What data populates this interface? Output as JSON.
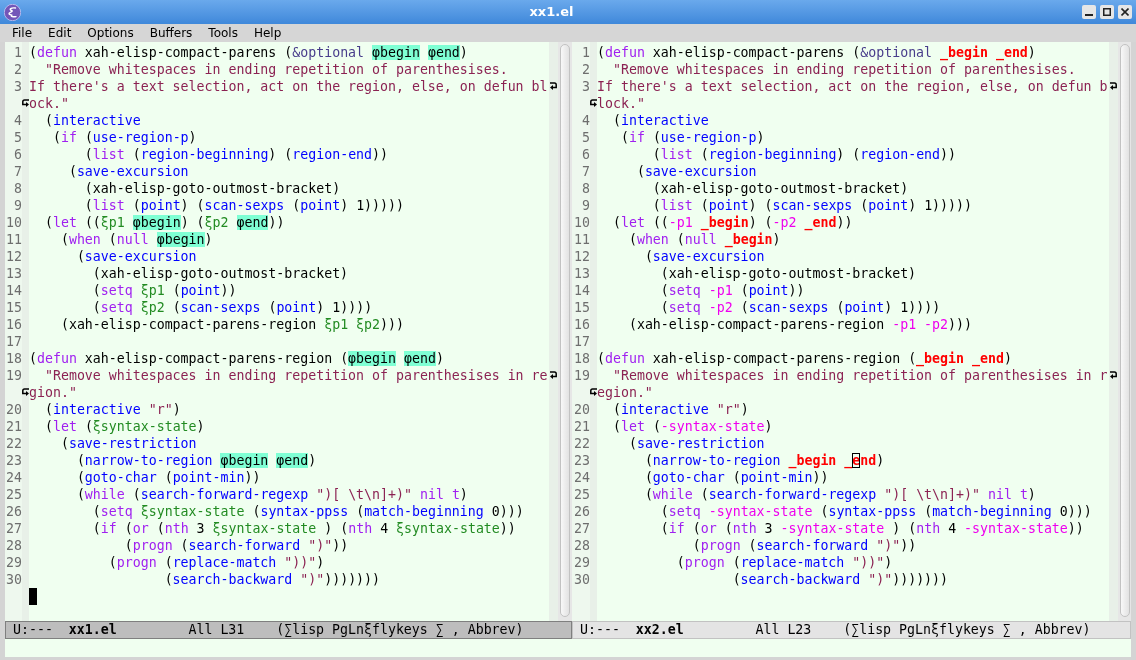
{
  "window": {
    "title": "xx1.el"
  },
  "menu": [
    "File",
    "Edit",
    "Options",
    "Buffers",
    "Tools",
    "Help"
  ],
  "windows": [
    {
      "selected": true,
      "lines": [
        {
          "number": "1",
          "rows": [
            [
              {
                "kind": "plain",
                "text": "("
              },
              {
                "kind": "keyword",
                "text": "defun"
              },
              {
                "kind": "plain",
                "text": " xah-elisp-compact-parens ("
              },
              {
                "kind": "modifier",
                "text": "&optional"
              },
              {
                "kind": "highlight",
                "text": " φbegin"
              },
              {
                "kind": "highlight",
                "text": " φend"
              },
              {
                "kind": "plain",
                "text": ")"
              }
            ]
          ]
        },
        {
          "number": "2",
          "rows": [
            [
              {
                "kind": "string",
                "text": "  \"Remove whitespaces in ending repetition of parenthesises."
              }
            ]
          ]
        },
        {
          "number": "3",
          "rows": [
            [
              {
                "kind": "string",
                "text": "If there's a text selection, act on the region, else, on defun bl"
              }
            ],
            [
              {
                "kind": "string",
                "text": "ock.\""
              }
            ]
          ]
        },
        {
          "number": "4",
          "rows": [
            [
              {
                "kind": "plain",
                "text": "  ("
              },
              {
                "kind": "function",
                "text": "interactive"
              }
            ]
          ]
        },
        {
          "number": "5",
          "rows": [
            [
              {
                "kind": "plain",
                "text": "   ("
              },
              {
                "kind": "keyword",
                "text": "if"
              },
              {
                "kind": "plain",
                "text": " ("
              },
              {
                "kind": "function",
                "text": "use-region-p"
              },
              {
                "kind": "plain",
                "text": ")"
              }
            ]
          ]
        },
        {
          "number": "6",
          "rows": [
            [
              {
                "kind": "plain",
                "text": "       ("
              },
              {
                "kind": "keyword",
                "text": "list"
              },
              {
                "kind": "plain",
                "text": " ("
              },
              {
                "kind": "function",
                "text": "region-beginning"
              },
              {
                "kind": "plain",
                "text": ") ("
              },
              {
                "kind": "function",
                "text": "region-end"
              },
              {
                "kind": "plain",
                "text": "))"
              }
            ]
          ]
        },
        {
          "number": "7",
          "rows": [
            [
              {
                "kind": "plain",
                "text": "     ("
              },
              {
                "kind": "function",
                "text": "save-excursion"
              }
            ]
          ]
        },
        {
          "number": "8",
          "rows": [
            [
              {
                "kind": "plain",
                "text": "       (xah-elisp-goto-outmost-bracket)"
              }
            ]
          ]
        },
        {
          "number": "9",
          "rows": [
            [
              {
                "kind": "plain",
                "text": "       ("
              },
              {
                "kind": "keyword",
                "text": "list"
              },
              {
                "kind": "plain",
                "text": " ("
              },
              {
                "kind": "function",
                "text": "point"
              },
              {
                "kind": "plain",
                "text": ") ("
              },
              {
                "kind": "function",
                "text": "scan-sexps"
              },
              {
                "kind": "plain",
                "text": " ("
              },
              {
                "kind": "function",
                "text": "point"
              },
              {
                "kind": "plain",
                "text": ") 1)))))"
              }
            ]
          ]
        },
        {
          "number": "10",
          "rows": [
            [
              {
                "kind": "plain",
                "text": "  ("
              },
              {
                "kind": "keyword",
                "text": "let"
              },
              {
                "kind": "plain",
                "text": " (("
              },
              {
                "kind": "variable",
                "text": "ξp1"
              },
              {
                "kind": "highlight",
                "text": " φbegin"
              },
              {
                "kind": "plain",
                "text": ") ("
              },
              {
                "kind": "variable",
                "text": "ξp2"
              },
              {
                "kind": "highlight",
                "text": " φend"
              },
              {
                "kind": "plain",
                "text": "))"
              }
            ]
          ]
        },
        {
          "number": "11",
          "rows": [
            [
              {
                "kind": "plain",
                "text": "    ("
              },
              {
                "kind": "keyword",
                "text": "when"
              },
              {
                "kind": "plain",
                "text": " ("
              },
              {
                "kind": "keyword",
                "text": "null"
              },
              {
                "kind": "highlight",
                "text": " φbegin"
              },
              {
                "kind": "plain",
                "text": ")"
              }
            ]
          ]
        },
        {
          "number": "12",
          "rows": [
            [
              {
                "kind": "plain",
                "text": "      ("
              },
              {
                "kind": "function",
                "text": "save-excursion"
              }
            ]
          ]
        },
        {
          "number": "13",
          "rows": [
            [
              {
                "kind": "plain",
                "text": "        (xah-elisp-goto-outmost-bracket)"
              }
            ]
          ]
        },
        {
          "number": "14",
          "rows": [
            [
              {
                "kind": "plain",
                "text": "        ("
              },
              {
                "kind": "keyword",
                "text": "setq"
              },
              {
                "kind": "variable",
                "text": " ξp1"
              },
              {
                "kind": "plain",
                "text": " ("
              },
              {
                "kind": "function",
                "text": "point"
              },
              {
                "kind": "plain",
                "text": "))"
              }
            ]
          ]
        },
        {
          "number": "15",
          "rows": [
            [
              {
                "kind": "plain",
                "text": "        ("
              },
              {
                "kind": "keyword",
                "text": "setq"
              },
              {
                "kind": "variable",
                "text": " ξp2"
              },
              {
                "kind": "plain",
                "text": " ("
              },
              {
                "kind": "function",
                "text": "scan-sexps"
              },
              {
                "kind": "plain",
                "text": " ("
              },
              {
                "kind": "function",
                "text": "point"
              },
              {
                "kind": "plain",
                "text": ") 1))))"
              }
            ]
          ]
        },
        {
          "number": "16",
          "rows": [
            [
              {
                "kind": "plain",
                "text": "    (xah-elisp-compact-parens-region"
              },
              {
                "kind": "variable",
                "text": " ξp1"
              },
              {
                "kind": "variable",
                "text": " ξp2"
              },
              {
                "kind": "plain",
                "text": ")))"
              }
            ]
          ]
        },
        {
          "number": "17"
        },
        {
          "number": "18",
          "rows": [
            [
              {
                "kind": "plain",
                "text": "("
              },
              {
                "kind": "keyword",
                "text": "defun"
              },
              {
                "kind": "plain",
                "text": " xah-elisp-compact-parens-region ("
              },
              {
                "kind": "highlight",
                "text": "φbegin"
              },
              {
                "kind": "highlight",
                "text": " φend"
              },
              {
                "kind": "plain",
                "text": ")"
              }
            ]
          ]
        },
        {
          "number": "19",
          "rows": [
            [
              {
                "kind": "string",
                "text": "  \"Remove whitespaces in ending repetition of parenthesises in re"
              }
            ],
            [
              {
                "kind": "string",
                "text": "gion.\""
              }
            ]
          ]
        },
        {
          "number": "20",
          "rows": [
            [
              {
                "kind": "plain",
                "text": "  ("
              },
              {
                "kind": "function",
                "text": "interactive"
              },
              {
                "kind": "string",
                "text": " \"r\""
              },
              {
                "kind": "plain",
                "text": ")"
              }
            ]
          ]
        },
        {
          "number": "21",
          "rows": [
            [
              {
                "kind": "plain",
                "text": "  ("
              },
              {
                "kind": "keyword",
                "text": "let"
              },
              {
                "kind": "plain",
                "text": " ("
              },
              {
                "kind": "variable",
                "text": "ξsyntax-state"
              },
              {
                "kind": "plain",
                "text": ")"
              }
            ]
          ]
        },
        {
          "number": "22",
          "rows": [
            [
              {
                "kind": "plain",
                "text": "    ("
              },
              {
                "kind": "function",
                "text": "save-restriction"
              }
            ]
          ]
        },
        {
          "number": "23",
          "rows": [
            [
              {
                "kind": "plain",
                "text": "      ("
              },
              {
                "kind": "function",
                "text": "narrow-to-region"
              },
              {
                "kind": "highlight",
                "text": " φbegin"
              },
              {
                "kind": "highlight",
                "text": " φend"
              },
              {
                "kind": "plain",
                "text": ")"
              }
            ]
          ]
        },
        {
          "number": "24",
          "rows": [
            [
              {
                "kind": "plain",
                "text": "      ("
              },
              {
                "kind": "function",
                "text": "goto-char"
              },
              {
                "kind": "plain",
                "text": " ("
              },
              {
                "kind": "function",
                "text": "point-min"
              },
              {
                "kind": "plain",
                "text": "))"
              }
            ]
          ]
        },
        {
          "number": "25",
          "rows": [
            [
              {
                "kind": "plain",
                "text": "      ("
              },
              {
                "kind": "keyword",
                "text": "while"
              },
              {
                "kind": "plain",
                "text": " ("
              },
              {
                "kind": "function",
                "text": "search-forward-regexp"
              },
              {
                "kind": "string",
                "text": " \")[ \\t\\n]+)\""
              },
              {
                "kind": "keyword",
                "text": " nil"
              },
              {
                "kind": "keyword",
                "text": " t"
              },
              {
                "kind": "plain",
                "text": ")"
              }
            ]
          ]
        },
        {
          "number": "26",
          "rows": [
            [
              {
                "kind": "plain",
                "text": "        ("
              },
              {
                "kind": "keyword",
                "text": "setq"
              },
              {
                "kind": "variable",
                "text": " ξsyntax-state"
              },
              {
                "kind": "plain",
                "text": " ("
              },
              {
                "kind": "function",
                "text": "syntax-ppss"
              },
              {
                "kind": "plain",
                "text": " ("
              },
              {
                "kind": "function",
                "text": "match-beginning"
              },
              {
                "kind": "plain",
                "text": " 0)))"
              }
            ]
          ]
        },
        {
          "number": "27",
          "rows": [
            [
              {
                "kind": "plain",
                "text": "        ("
              },
              {
                "kind": "keyword",
                "text": "if"
              },
              {
                "kind": "plain",
                "text": " ("
              },
              {
                "kind": "keyword",
                "text": "or"
              },
              {
                "kind": "plain",
                "text": " ("
              },
              {
                "kind": "keyword",
                "text": "nth"
              },
              {
                "kind": "plain",
                "text": " 3"
              },
              {
                "kind": "variable",
                "text": " ξsyntax-state"
              },
              {
                "kind": "plain",
                "text": " ) ("
              },
              {
                "kind": "keyword",
                "text": "nth"
              },
              {
                "kind": "plain",
                "text": " 4"
              },
              {
                "kind": "variable",
                "text": " ξsyntax-state"
              },
              {
                "kind": "plain",
                "text": "))"
              }
            ]
          ]
        },
        {
          "number": "28",
          "rows": [
            [
              {
                "kind": "plain",
                "text": "            ("
              },
              {
                "kind": "keyword",
                "text": "progn"
              },
              {
                "kind": "plain",
                "text": " ("
              },
              {
                "kind": "function",
                "text": "search-forward"
              },
              {
                "kind": "string",
                "text": " \")\""
              },
              {
                "kind": "plain",
                "text": "))"
              }
            ]
          ]
        },
        {
          "number": "29",
          "rows": [
            [
              {
                "kind": "plain",
                "text": "          ("
              },
              {
                "kind": "keyword",
                "text": "progn"
              },
              {
                "kind": "plain",
                "text": " ("
              },
              {
                "kind": "function",
                "text": "replace-match"
              },
              {
                "kind": "string",
                "text": " \"))\""
              },
              {
                "kind": "plain",
                "text": ")"
              }
            ]
          ]
        },
        {
          "number": "30",
          "rows": [
            [
              {
                "kind": "plain",
                "text": "                 ("
              },
              {
                "kind": "function",
                "text": "search-backward"
              },
              {
                "kind": "string",
                "text": " \")\""
              },
              {
                "kind": "plain",
                "text": ")))))))"
              }
            ]
          ]
        },
        {
          "cursor": true
        }
      ],
      "mode_line": {
        "status": "U:---",
        "buffer": "xx1.el",
        "position": "All L31",
        "modes": "(∑lisp PgLnξflykeys ∑ , Abbrev)"
      }
    },
    {
      "selected": false,
      "lines": [
        {
          "number": "1",
          "rows": [
            [
              {
                "kind": "plain",
                "text": "("
              },
              {
                "kind": "keyword",
                "text": "defun"
              },
              {
                "kind": "plain",
                "text": " xah-elisp-compact-parens ("
              },
              {
                "kind": "modifier",
                "text": "&optional"
              },
              {
                "kind": "param",
                "text": " _begin"
              },
              {
                "kind": "param",
                "text": " _end"
              },
              {
                "kind": "plain",
                "text": ")"
              }
            ]
          ]
        },
        {
          "number": "2",
          "rows": [
            [
              {
                "kind": "string",
                "text": "  \"Remove whitespaces in ending repetition of parenthesises."
              }
            ]
          ]
        },
        {
          "number": "3",
          "rows": [
            [
              {
                "kind": "string",
                "text": "If there's a text selection, act on the region, else, on defun b"
              }
            ],
            [
              {
                "kind": "string",
                "text": "lock.\""
              }
            ]
          ]
        },
        {
          "number": "4",
          "rows": [
            [
              {
                "kind": "plain",
                "text": "  ("
              },
              {
                "kind": "function",
                "text": "interactive"
              }
            ]
          ]
        },
        {
          "number": "5",
          "rows": [
            [
              {
                "kind": "plain",
                "text": "   ("
              },
              {
                "kind": "keyword",
                "text": "if"
              },
              {
                "kind": "plain",
                "text": " ("
              },
              {
                "kind": "function",
                "text": "use-region-p"
              },
              {
                "kind": "plain",
                "text": ")"
              }
            ]
          ]
        },
        {
          "number": "6",
          "rows": [
            [
              {
                "kind": "plain",
                "text": "       ("
              },
              {
                "kind": "keyword",
                "text": "list"
              },
              {
                "kind": "plain",
                "text": " ("
              },
              {
                "kind": "function",
                "text": "region-beginning"
              },
              {
                "kind": "plain",
                "text": ") ("
              },
              {
                "kind": "function",
                "text": "region-end"
              },
              {
                "kind": "plain",
                "text": "))"
              }
            ]
          ]
        },
        {
          "number": "7",
          "rows": [
            [
              {
                "kind": "plain",
                "text": "     ("
              },
              {
                "kind": "function",
                "text": "save-excursion"
              }
            ]
          ]
        },
        {
          "number": "8",
          "rows": [
            [
              {
                "kind": "plain",
                "text": "       (xah-elisp-goto-outmost-bracket)"
              }
            ]
          ]
        },
        {
          "number": "9",
          "rows": [
            [
              {
                "kind": "plain",
                "text": "       ("
              },
              {
                "kind": "keyword",
                "text": "list"
              },
              {
                "kind": "plain",
                "text": " ("
              },
              {
                "kind": "function",
                "text": "point"
              },
              {
                "kind": "plain",
                "text": ") ("
              },
              {
                "kind": "function",
                "text": "scan-sexps"
              },
              {
                "kind": "plain",
                "text": " ("
              },
              {
                "kind": "function",
                "text": "point"
              },
              {
                "kind": "plain",
                "text": ") 1)))))"
              }
            ]
          ]
        },
        {
          "number": "10",
          "rows": [
            [
              {
                "kind": "plain",
                "text": "  ("
              },
              {
                "kind": "keyword",
                "text": "let"
              },
              {
                "kind": "plain",
                "text": " (("
              },
              {
                "kind": "local",
                "text": "-p1"
              },
              {
                "kind": "param",
                "text": " _begin"
              },
              {
                "kind": "plain",
                "text": ") ("
              },
              {
                "kind": "local",
                "text": "-p2"
              },
              {
                "kind": "param",
                "text": " _end"
              },
              {
                "kind": "plain",
                "text": "))"
              }
            ]
          ]
        },
        {
          "number": "11",
          "rows": [
            [
              {
                "kind": "plain",
                "text": "    ("
              },
              {
                "kind": "keyword",
                "text": "when"
              },
              {
                "kind": "plain",
                "text": " ("
              },
              {
                "kind": "keyword",
                "text": "null"
              },
              {
                "kind": "param",
                "text": " _begin"
              },
              {
                "kind": "plain",
                "text": ")"
              }
            ]
          ]
        },
        {
          "number": "12",
          "rows": [
            [
              {
                "kind": "plain",
                "text": "      ("
              },
              {
                "kind": "function",
                "text": "save-excursion"
              }
            ]
          ]
        },
        {
          "number": "13",
          "rows": [
            [
              {
                "kind": "plain",
                "text": "        (xah-elisp-goto-outmost-bracket)"
              }
            ]
          ]
        },
        {
          "number": "14",
          "rows": [
            [
              {
                "kind": "plain",
                "text": "        ("
              },
              {
                "kind": "keyword",
                "text": "setq"
              },
              {
                "kind": "local",
                "text": " -p1"
              },
              {
                "kind": "plain",
                "text": " ("
              },
              {
                "kind": "function",
                "text": "point"
              },
              {
                "kind": "plain",
                "text": "))"
              }
            ]
          ]
        },
        {
          "number": "15",
          "rows": [
            [
              {
                "kind": "plain",
                "text": "        ("
              },
              {
                "kind": "keyword",
                "text": "setq"
              },
              {
                "kind": "local",
                "text": " -p2"
              },
              {
                "kind": "plain",
                "text": " ("
              },
              {
                "kind": "function",
                "text": "scan-sexps"
              },
              {
                "kind": "plain",
                "text": " ("
              },
              {
                "kind": "function",
                "text": "point"
              },
              {
                "kind": "plain",
                "text": ") 1))))"
              }
            ]
          ]
        },
        {
          "number": "16",
          "rows": [
            [
              {
                "kind": "plain",
                "text": "    (xah-elisp-compact-parens-region"
              },
              {
                "kind": "local",
                "text": " -p1"
              },
              {
                "kind": "local",
                "text": " -p2"
              },
              {
                "kind": "plain",
                "text": ")))"
              }
            ]
          ]
        },
        {
          "number": "17"
        },
        {
          "number": "18",
          "rows": [
            [
              {
                "kind": "plain",
                "text": "("
              },
              {
                "kind": "keyword",
                "text": "defun"
              },
              {
                "kind": "plain",
                "text": " xah-elisp-compact-parens-region ("
              },
              {
                "kind": "param",
                "text": "_begin"
              },
              {
                "kind": "param",
                "text": " _end"
              },
              {
                "kind": "plain",
                "text": ")"
              }
            ]
          ]
        },
        {
          "number": "19",
          "rows": [
            [
              {
                "kind": "string",
                "text": "  \"Remove whitespaces in ending repetition of parenthesises in r"
              }
            ],
            [
              {
                "kind": "string",
                "text": "egion.\""
              }
            ]
          ]
        },
        {
          "number": "20",
          "rows": [
            [
              {
                "kind": "plain",
                "text": "  ("
              },
              {
                "kind": "function",
                "text": "interactive"
              },
              {
                "kind": "string",
                "text": " \"r\""
              },
              {
                "kind": "plain",
                "text": ")"
              }
            ]
          ]
        },
        {
          "number": "21",
          "rows": [
            [
              {
                "kind": "plain",
                "text": "  ("
              },
              {
                "kind": "keyword",
                "text": "let"
              },
              {
                "kind": "plain",
                "text": " ("
              },
              {
                "kind": "local",
                "text": "-syntax-state"
              },
              {
                "kind": "plain",
                "text": ")"
              }
            ]
          ]
        },
        {
          "number": "22",
          "rows": [
            [
              {
                "kind": "plain",
                "text": "    ("
              },
              {
                "kind": "function",
                "text": "save-restriction"
              }
            ]
          ]
        },
        {
          "number": "23",
          "rows": [
            [
              {
                "kind": "plain",
                "text": "      ("
              },
              {
                "kind": "function",
                "text": "narrow-to-region"
              },
              {
                "kind": "param",
                "text": " _begin"
              },
              {
                "kind": "param",
                "text": " _"
              },
              {
                "kind": "param",
                "text": "e",
                "cursor": true
              },
              {
                "kind": "param",
                "text": "nd"
              },
              {
                "kind": "plain",
                "text": ")"
              }
            ]
          ]
        },
        {
          "number": "24",
          "rows": [
            [
              {
                "kind": "plain",
                "text": "      ("
              },
              {
                "kind": "function",
                "text": "goto-char"
              },
              {
                "kind": "plain",
                "text": " ("
              },
              {
                "kind": "function",
                "text": "point-min"
              },
              {
                "kind": "plain",
                "text": "))"
              }
            ]
          ]
        },
        {
          "number": "25",
          "rows": [
            [
              {
                "kind": "plain",
                "text": "      ("
              },
              {
                "kind": "keyword",
                "text": "while"
              },
              {
                "kind": "plain",
                "text": " ("
              },
              {
                "kind": "function",
                "text": "search-forward-regexp"
              },
              {
                "kind": "string",
                "text": " \")[ \\t\\n]+)\""
              },
              {
                "kind": "keyword",
                "text": " nil"
              },
              {
                "kind": "keyword",
                "text": " t"
              },
              {
                "kind": "plain",
                "text": ")"
              }
            ]
          ]
        },
        {
          "number": "26",
          "rows": [
            [
              {
                "kind": "plain",
                "text": "        ("
              },
              {
                "kind": "keyword",
                "text": "setq"
              },
              {
                "kind": "local",
                "text": " -syntax-state"
              },
              {
                "kind": "plain",
                "text": " ("
              },
              {
                "kind": "function",
                "text": "syntax-ppss"
              },
              {
                "kind": "plain",
                "text": " ("
              },
              {
                "kind": "function",
                "text": "match-beginning"
              },
              {
                "kind": "plain",
                "text": " 0)))"
              }
            ]
          ]
        },
        {
          "number": "27",
          "rows": [
            [
              {
                "kind": "plain",
                "text": "        ("
              },
              {
                "kind": "keyword",
                "text": "if"
              },
              {
                "kind": "plain",
                "text": " ("
              },
              {
                "kind": "keyword",
                "text": "or"
              },
              {
                "kind": "plain",
                "text": " ("
              },
              {
                "kind": "keyword",
                "text": "nth"
              },
              {
                "kind": "plain",
                "text": " 3"
              },
              {
                "kind": "local",
                "text": " -syntax-state"
              },
              {
                "kind": "plain",
                "text": " ) ("
              },
              {
                "kind": "keyword",
                "text": "nth"
              },
              {
                "kind": "plain",
                "text": " 4"
              },
              {
                "kind": "local",
                "text": " -syntax-state"
              },
              {
                "kind": "plain",
                "text": "))"
              }
            ]
          ]
        },
        {
          "number": "28",
          "rows": [
            [
              {
                "kind": "plain",
                "text": "            ("
              },
              {
                "kind": "keyword",
                "text": "progn"
              },
              {
                "kind": "plain",
                "text": " ("
              },
              {
                "kind": "function",
                "text": "search-forward"
              },
              {
                "kind": "string",
                "text": " \")\""
              },
              {
                "kind": "plain",
                "text": "))"
              }
            ]
          ]
        },
        {
          "number": "29",
          "rows": [
            [
              {
                "kind": "plain",
                "text": "          ("
              },
              {
                "kind": "keyword",
                "text": "progn"
              },
              {
                "kind": "plain",
                "text": " ("
              },
              {
                "kind": "function",
                "text": "replace-match"
              },
              {
                "kind": "string",
                "text": " \"))\""
              },
              {
                "kind": "plain",
                "text": ")"
              }
            ]
          ]
        },
        {
          "number": "30",
          "rows": [
            [
              {
                "kind": "plain",
                "text": "                 ("
              },
              {
                "kind": "function",
                "text": "search-backward"
              },
              {
                "kind": "string",
                "text": " \")\""
              },
              {
                "kind": "plain",
                "text": ")))))))"
              }
            ]
          ]
        }
      ],
      "mode_line": {
        "status": "U:---",
        "buffer": "xx2.el",
        "position": "All L23",
        "modes": "(∑lisp PgLnξflykeys ∑ , Abbrev)"
      }
    }
  ]
}
